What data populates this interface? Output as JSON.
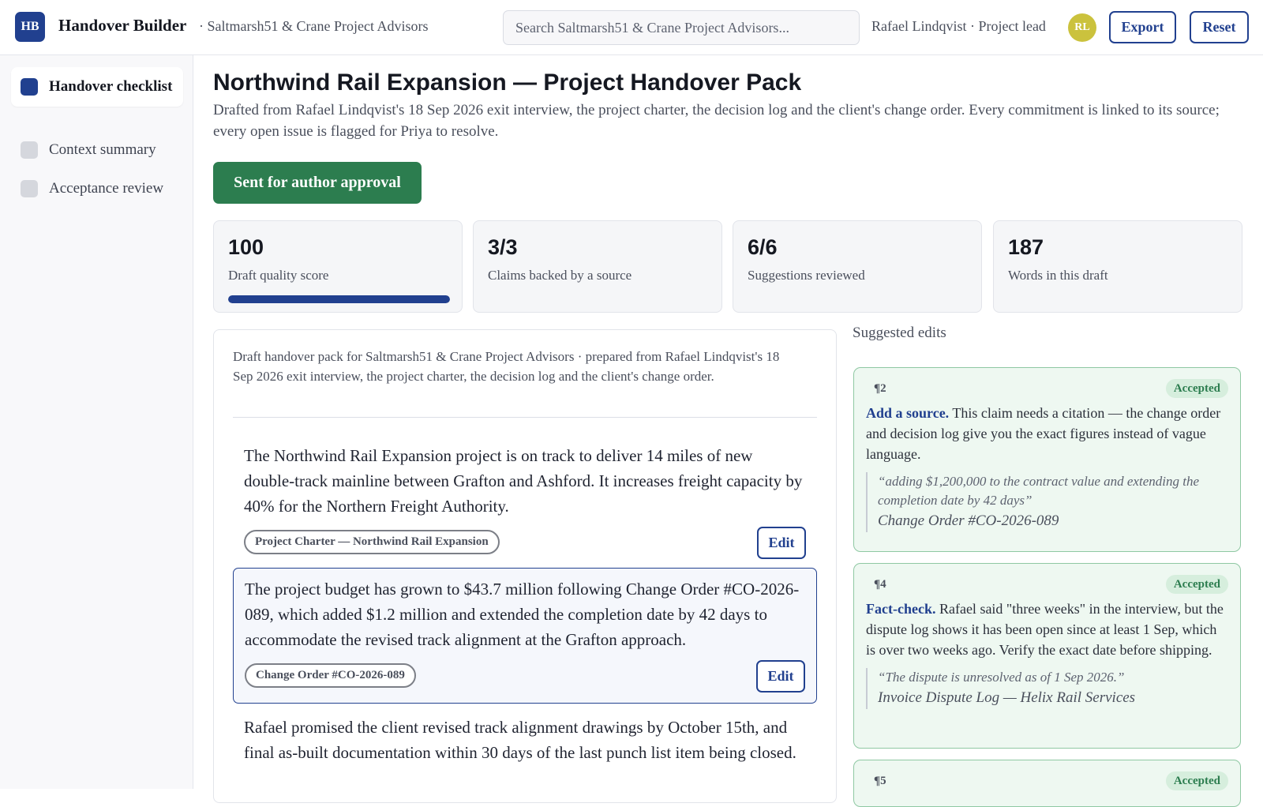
{
  "header": {
    "logo_text": "HB",
    "app_title": "Handover Builder",
    "org": "· Saltmarsh51 & Crane Project Advisors",
    "search_placeholder": "Search Saltmarsh51 & Crane Project Advisors...",
    "user": "Rafael Lindqvist · Project lead",
    "avatar_initials": "RL",
    "export_label": "Export",
    "reset_label": "Reset"
  },
  "sidebar": {
    "items": [
      {
        "label": "Handover checklist",
        "active": true
      },
      {
        "label": "Context summary",
        "active": false
      },
      {
        "label": "Acceptance review",
        "active": false
      }
    ]
  },
  "main": {
    "title": "Northwind Rail Expansion — Project Handover Pack",
    "subtitle": "Drafted from Rafael Lindqvist's 18 Sep 2026 exit interview, the project charter, the decision log and the client's change order. Every commitment is linked to its source; every open issue is flagged for Priya to resolve.",
    "status_label": "Sent for author approval",
    "stats": [
      {
        "value": "100",
        "label": "Draft quality score",
        "progress": 1.0
      },
      {
        "value": "3/3",
        "label": "Claims backed by a source"
      },
      {
        "value": "6/6",
        "label": "Suggestions reviewed"
      },
      {
        "value": "187",
        "label": "Words in this draft"
      }
    ]
  },
  "draft": {
    "intro": "Draft handover pack for Saltmarsh51 & Crane Project Advisors · prepared from Rafael Lindqvist's 18 Sep 2026 exit interview, the project charter, the decision log and the client's change order.",
    "paragraphs": [
      {
        "text": "The Northwind Rail Expansion project is on track to deliver 14 miles of new double-track mainline between Grafton and Ashford. It increases freight capacity by 40% for the Northern Freight Authority.",
        "source": "Project Charter — Northwind Rail Expansion",
        "edit_label": "Edit"
      },
      {
        "text": "The project budget has grown to $43.7 million following Change Order #CO-2026-089, which added $1.2 million and extended the completion date by 42 days to accommodate the revised track alignment at the Grafton approach.",
        "source": "Change Order #CO-2026-089",
        "edit_label": "Edit"
      },
      {
        "text": "Rafael promised the client revised track alignment drawings by October 15th, and final as-built documentation within 30 days of the last punch list item being closed."
      }
    ]
  },
  "suggestions": {
    "title": "Suggested edits",
    "items": [
      {
        "para": "¶2",
        "status": "Accepted",
        "kind": "Add a source.",
        "body": "This claim needs a citation — the change order and decision log give you the exact figures instead of vague language.",
        "quote": "“adding $1,200,000 to the contract value and extending the completion date by 42 days”",
        "quote_source": "Change Order #CO-2026-089"
      },
      {
        "para": "¶4",
        "status": "Accepted",
        "kind": "Fact-check.",
        "body": "Rafael said \"three weeks\" in the interview, but the dispute log shows it has been open since at least 1 Sep, which is over two weeks ago. Verify the exact date before shipping.",
        "quote": "“The dispute is unresolved as of 1 Sep 2026.”",
        "quote_source": "Invoice Dispute Log — Helix Rail Services"
      },
      {
        "para": "¶5",
        "status": "Accepted"
      }
    ]
  },
  "colors": {
    "accent": "#21408f",
    "success": "#2c7d4f",
    "avatar": "#cbc23d"
  }
}
